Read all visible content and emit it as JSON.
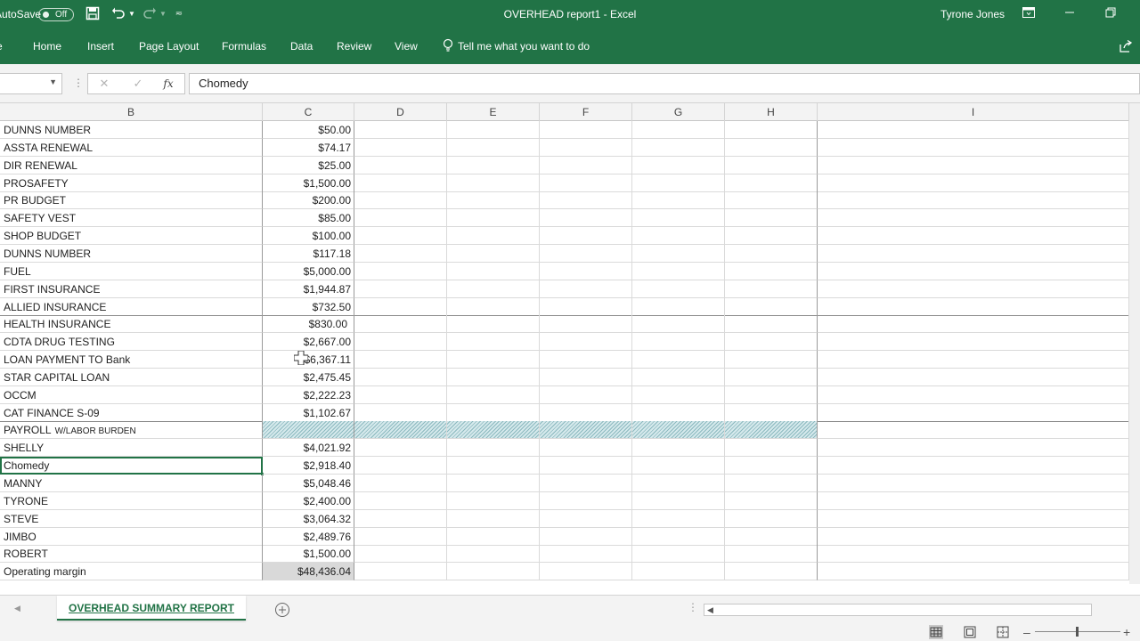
{
  "titlebar": {
    "autosave_label": "AutoSave",
    "autosave_state": "Off",
    "title": "OVERHEAD report1  -  Excel",
    "user": "Tyrone Jones"
  },
  "ribbon": {
    "tabs": [
      "Home",
      "Insert",
      "Page Layout",
      "Formulas",
      "Data",
      "Review",
      "View"
    ],
    "tell_me": "Tell me what you want to do"
  },
  "formula_bar": {
    "fx": "fx",
    "content": "Chomedy"
  },
  "columns": [
    "B",
    "C",
    "D",
    "E",
    "F",
    "G",
    "H",
    "I"
  ],
  "rows": [
    {
      "label": "DUNNS NUMBER",
      "value": "$50.00"
    },
    {
      "label": "ASSTA RENEWAL",
      "value": "$74.17"
    },
    {
      "label": "DIR RENEWAL",
      "value": "$25.00"
    },
    {
      "label": "PROSAFETY",
      "value": "$1,500.00"
    },
    {
      "label": "PR BUDGET",
      "value": "$200.00"
    },
    {
      "label": "SAFETY VEST",
      "value": "$85.00"
    },
    {
      "label": "SHOP BUDGET",
      "value": "$100.00"
    },
    {
      "label": "DUNNS NUMBER",
      "value": "$117.18"
    },
    {
      "label": "FUEL",
      "value": "$5,000.00"
    },
    {
      "label": "FIRST INSURANCE",
      "value": "$1,944.87"
    },
    {
      "label": "ALLIED INSURANCE",
      "value": "$732.50"
    },
    {
      "label": "HEALTH INSURANCE",
      "value": "$830.00"
    },
    {
      "label": "CDTA DRUG TESTING",
      "value": "$2,667.00"
    },
    {
      "label": "LOAN PAYMENT TO Bank",
      "value": "$6,367.11"
    },
    {
      "label": "STAR CAPITAL LOAN",
      "value": "$2,475.45"
    },
    {
      "label": "OCCM",
      "value": "$2,222.23"
    },
    {
      "label": "CAT FINANCE S-09",
      "value": "$1,102.67"
    },
    {
      "label": "PAYROLL",
      "label_small": "W/LABOR BURDEN",
      "value": ""
    },
    {
      "label": "SHELLY",
      "value": "$4,021.92"
    },
    {
      "label": "Chomedy",
      "value": "$2,918.40"
    },
    {
      "label": "MANNY",
      "value": "$5,048.46"
    },
    {
      "label": "TYRONE",
      "value": "$2,400.00"
    },
    {
      "label": "STEVE",
      "value": "$3,064.32"
    },
    {
      "label": "JIMBO",
      "value": "$2,489.76"
    },
    {
      "label": "ROBERT",
      "value": "$1,500.00"
    },
    {
      "label": "Operating margin",
      "value": "$48,436.04"
    }
  ],
  "sheet": {
    "active_tab": "OVERHEAD SUMMARY REPORT"
  },
  "colors": {
    "excel_green": "#217346"
  }
}
